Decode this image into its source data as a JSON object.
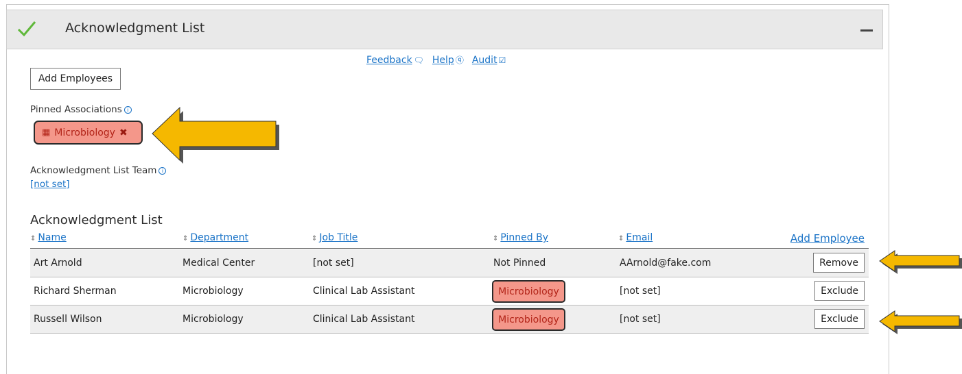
{
  "header": {
    "title": "Acknowledgment List"
  },
  "toplinks": [
    {
      "label": "Feedback",
      "icon": "speech-bubble-icon"
    },
    {
      "label": "Help",
      "icon": "question-circle-icon"
    },
    {
      "label": "Audit",
      "icon": "clipboard-check-icon"
    }
  ],
  "add_employees_label": "Add Employees",
  "pinned": {
    "label": "Pinned Associations",
    "tag_label": "Microbiology"
  },
  "team": {
    "label": "Acknowledgment List Team",
    "value": "[not set]"
  },
  "list": {
    "title": "Acknowledgment List",
    "columns": [
      "Name",
      "Department",
      "Job Title",
      "Pinned By",
      "Email"
    ],
    "add_employee_label": "Add Employee",
    "rows": [
      {
        "name": "Art Arnold",
        "department": "Medical Center",
        "job_title": "[not set]",
        "pinned_by": "Not Pinned",
        "email": "AArnold@fake.com",
        "action": "Remove"
      },
      {
        "name": "Richard Sherman",
        "department": "Microbiology",
        "job_title": "Clinical Lab Assistant",
        "pinned_by": "Microbiology",
        "email": "[not set]",
        "action": "Exclude"
      },
      {
        "name": "Russell Wilson",
        "department": "Microbiology",
        "job_title": "Clinical Lab Assistant",
        "pinned_by": "Microbiology",
        "email": "[not set]",
        "action": "Exclude"
      }
    ]
  },
  "colors": {
    "accent": "#1a73c7",
    "highlight": "#f4978a",
    "annotation_arrow": "#f5b800",
    "check": "#5fb83a"
  }
}
